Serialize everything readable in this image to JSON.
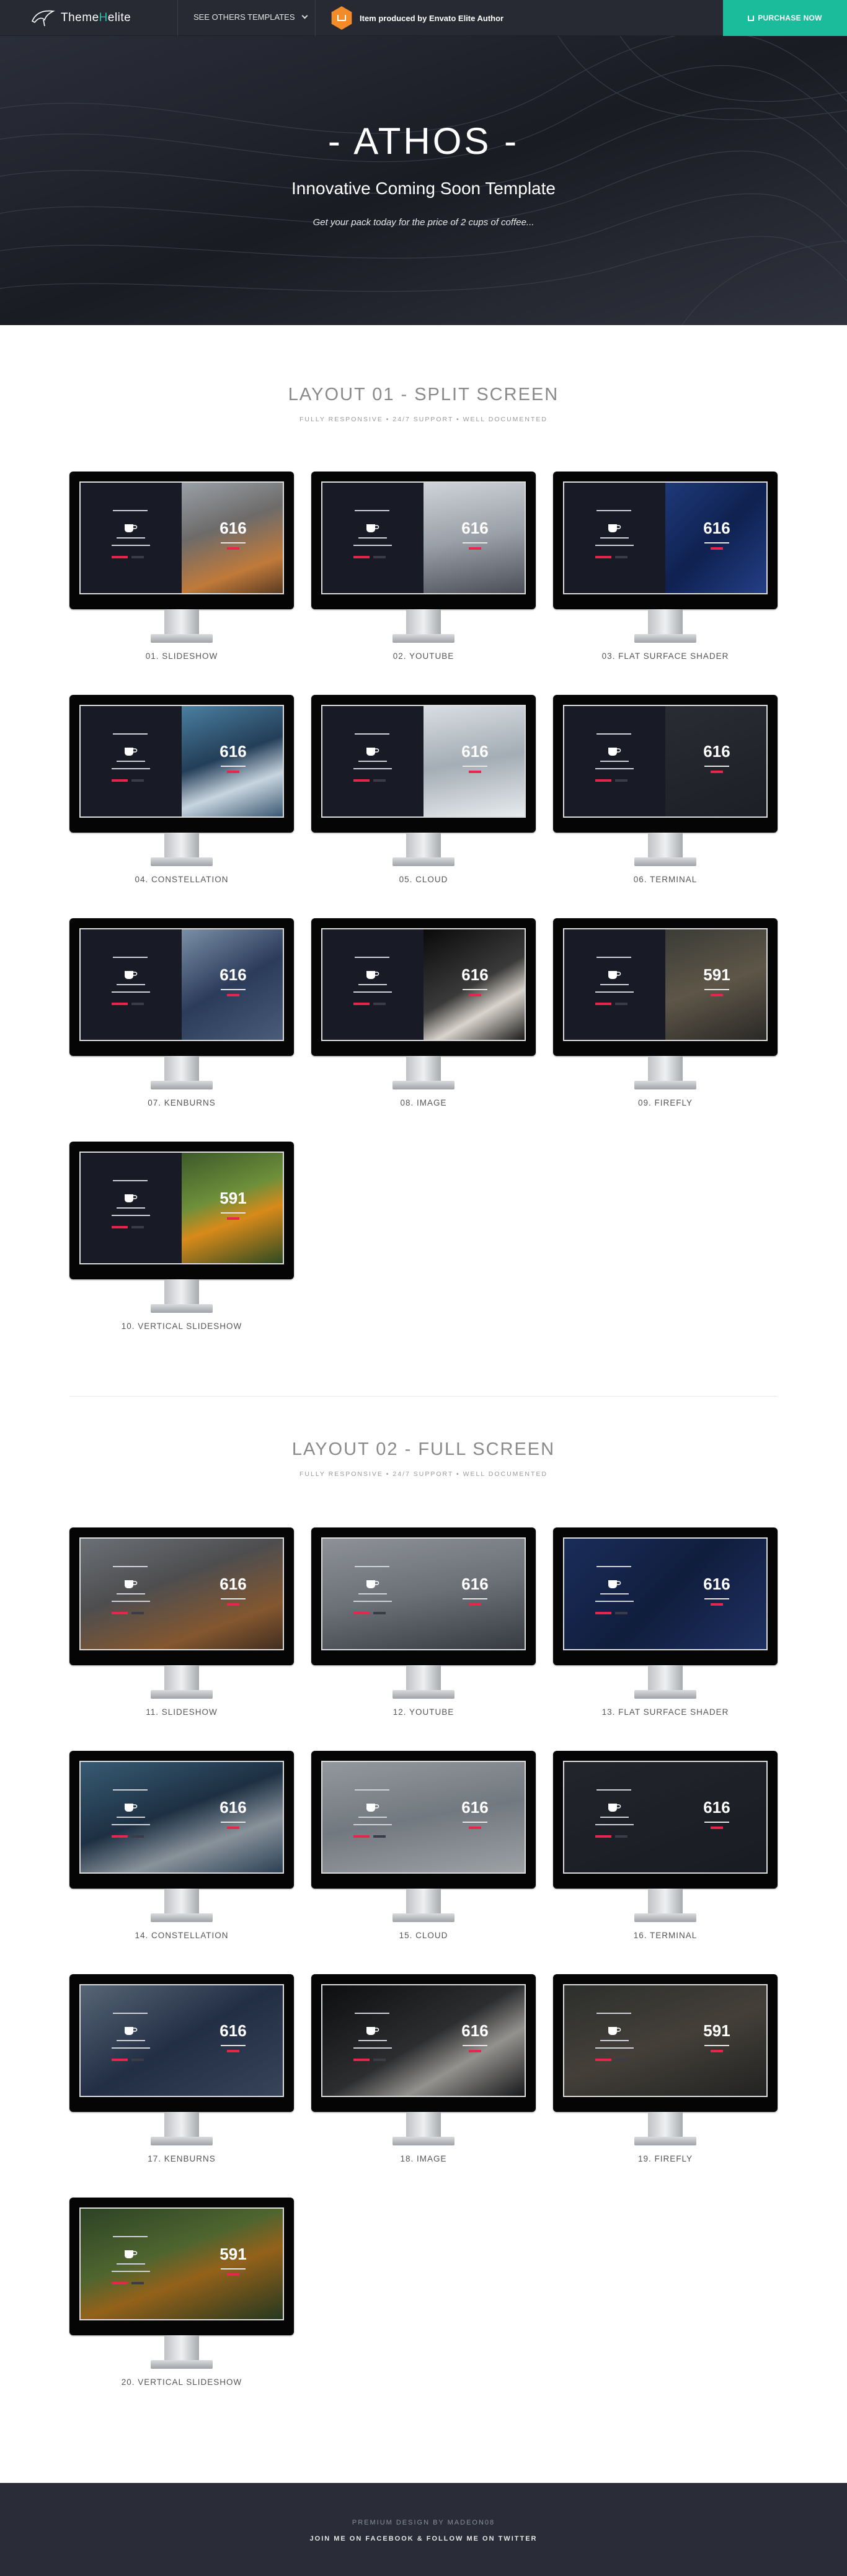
{
  "brand": {
    "logo_prefix": "Theme",
    "logo_h": "H",
    "logo_suffix": "elite"
  },
  "topbar": {
    "templates_label": "SEE OTHERS TEMPLATES",
    "elite_label": "Item produced by Envato Elite Author",
    "purchase_label": "PURCHASE NOW"
  },
  "hero": {
    "title": "- ATHOS -",
    "subtitle": "Innovative Coming Soon Template",
    "tagline": "Get your pack today for the price of 2 cups of coffee..."
  },
  "layout1": {
    "title": "LAYOUT 01 - SPLIT SCREEN",
    "subtitle": "FULLY RESPONSIVE • 24/7 SUPPORT • WELL DOCUMENTED",
    "items": [
      {
        "label": "01. SLIDESHOW",
        "number": "616"
      },
      {
        "label": "02. YOUTUBE",
        "number": "616"
      },
      {
        "label": "03. FLAT SURFACE SHADER",
        "number": "616"
      },
      {
        "label": "04. CONSTELLATION",
        "number": "616"
      },
      {
        "label": "05. CLOUD",
        "number": "616"
      },
      {
        "label": "06. TERMINAL",
        "number": "616"
      },
      {
        "label": "07. KENBURNS",
        "number": "616"
      },
      {
        "label": "08. IMAGE",
        "number": "616"
      },
      {
        "label": "09. FIREFLY",
        "number": "591"
      },
      {
        "label": "10. VERTICAL SLIDESHOW",
        "number": "591"
      }
    ]
  },
  "layout2": {
    "title": "LAYOUT 02 - FULL SCREEN",
    "subtitle": "FULLY RESPONSIVE • 24/7 SUPPORT • WELL DOCUMENTED",
    "items": [
      {
        "label": "11. SLIDESHOW",
        "number": "616"
      },
      {
        "label": "12. YOUTUBE",
        "number": "616"
      },
      {
        "label": "13. FLAT SURFACE SHADER",
        "number": "616"
      },
      {
        "label": "14. CONSTELLATION",
        "number": "616"
      },
      {
        "label": "15. CLOUD",
        "number": "616"
      },
      {
        "label": "16. TERMINAL",
        "number": "616"
      },
      {
        "label": "17. KENBURNS",
        "number": "616"
      },
      {
        "label": "18. IMAGE",
        "number": "616"
      },
      {
        "label": "19. FIREFLY",
        "number": "591"
      },
      {
        "label": "20. VERTICAL SLIDESHOW",
        "number": "591"
      }
    ]
  },
  "footer": {
    "credit": "PREMIUM DESIGN BY MADEON08",
    "facebook": "JOIN ME ON FACEBOOK",
    "separator": "&",
    "twitter": "FOLLOW ME ON TWITTER"
  },
  "colors": {
    "accent": "#1bbc9b",
    "highlight": "#e8264d",
    "dark": "#272a33",
    "orange": "#f28c28"
  }
}
